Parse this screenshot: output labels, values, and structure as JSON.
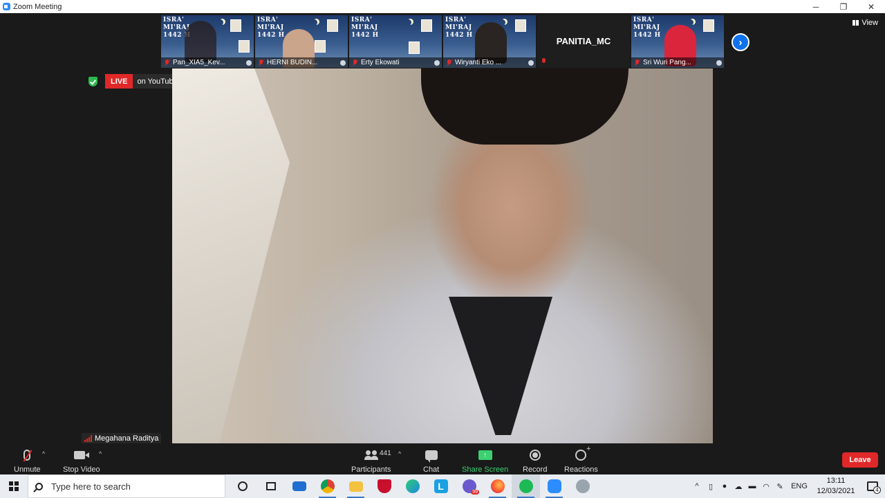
{
  "window": {
    "title": "Zoom Meeting",
    "controls": {
      "minimize": "─",
      "restore": "❐",
      "close": "✕"
    }
  },
  "gallery": {
    "tiles": [
      {
        "name": "Pan_XIA5_Kev...",
        "type": "poster",
        "poster_lines": [
          "ISRA'",
          "MI'RAJ",
          "1442 H"
        ]
      },
      {
        "name": "HERNI BUDIN...",
        "type": "poster",
        "poster_lines": [
          "ISRA'",
          "MI'RAJ",
          "1442 H"
        ]
      },
      {
        "name": "Erty Ekowati",
        "type": "poster",
        "poster_lines": [
          "ISRA'",
          "MI'RAJ",
          "1442 H"
        ]
      },
      {
        "name": "Wiryanti Eko ...",
        "type": "poster",
        "poster_lines": [
          "ISRA'",
          "MI'RAJ",
          "1442 H"
        ]
      },
      {
        "name": "PANITIA_MC",
        "type": "name-only"
      },
      {
        "name": "Sri Wuri Pang...",
        "type": "poster",
        "poster_lines": [
          "ISRA'",
          "MI'RAJ",
          "1442 H"
        ]
      }
    ],
    "next_page_icon": "chevron-right-icon"
  },
  "view_button": {
    "label": "View",
    "icon": "grid-icon"
  },
  "live": {
    "badge": "LIVE",
    "destination": "on YouTube",
    "security_icon": "shield-check-icon",
    "badge_color": "#e02828"
  },
  "active_speaker": {
    "name": "Megahana Raditya"
  },
  "toolbar": {
    "unmute": {
      "label": "Unmute",
      "icon": "microphone-muted-icon"
    },
    "stop_video": {
      "label": "Stop Video",
      "icon": "video-camera-icon"
    },
    "participants": {
      "label": "Participants",
      "count": "441",
      "icon": "participants-icon"
    },
    "chat": {
      "label": "Chat",
      "icon": "chat-bubble-icon"
    },
    "share_screen": {
      "label": "Share Screen",
      "icon": "share-screen-icon",
      "color": "#3bd16f"
    },
    "record": {
      "label": "Record",
      "icon": "record-icon"
    },
    "reactions": {
      "label": "Reactions",
      "icon": "reactions-icon"
    },
    "leave": {
      "label": "Leave",
      "color": "#e02828"
    }
  },
  "taskbar": {
    "search_placeholder": "Type here to search",
    "apps": [
      {
        "name": "cortana-icon"
      },
      {
        "name": "task-view-icon"
      },
      {
        "name": "mail-icon"
      },
      {
        "name": "chrome-icon"
      },
      {
        "name": "file-explorer-icon"
      },
      {
        "name": "mcafee-icon"
      },
      {
        "name": "edge-icon"
      },
      {
        "name": "l-app-icon"
      },
      {
        "name": "notification-app-icon",
        "badge": "99"
      },
      {
        "name": "firefox-icon"
      },
      {
        "name": "spotify-icon"
      },
      {
        "name": "zoom-icon"
      },
      {
        "name": "app-icon"
      }
    ],
    "tray": {
      "language": "ENG",
      "time": "13:11",
      "date": "12/03/2021",
      "notification_count": "4"
    }
  }
}
